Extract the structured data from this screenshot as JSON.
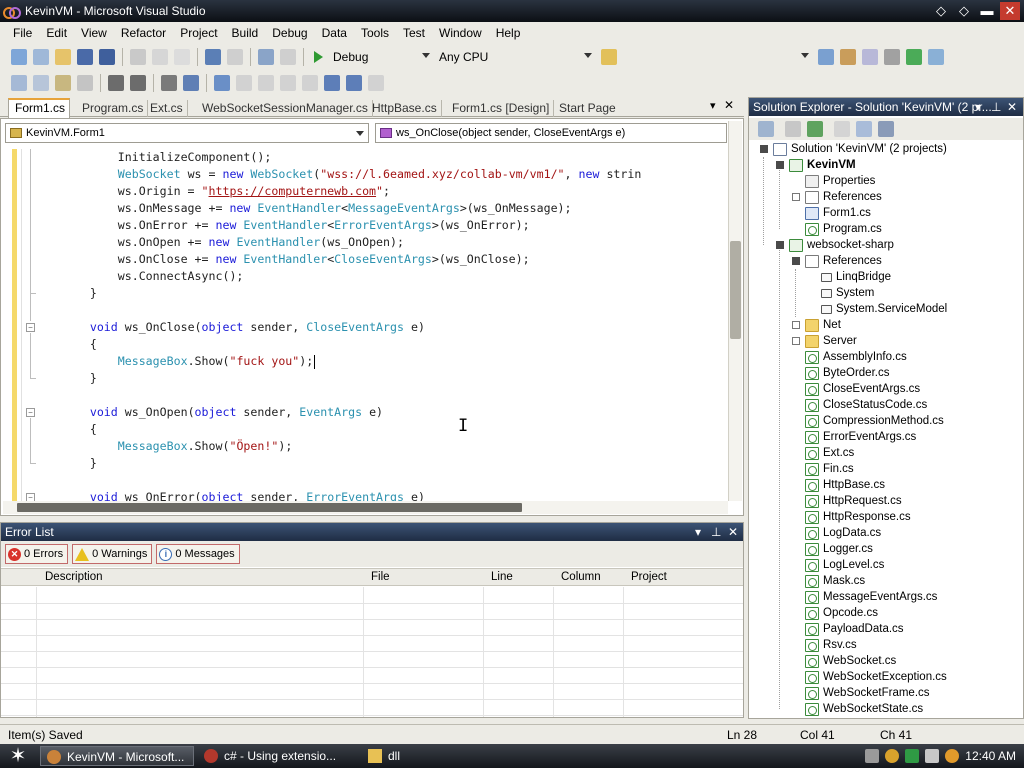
{
  "window": {
    "title": "KevinVM - Microsoft Visual Studio",
    "controls": [
      "diamond-icon",
      "diamond-icon",
      "minimize-icon",
      "close-icon"
    ]
  },
  "menu": [
    "File",
    "Edit",
    "View",
    "Refactor",
    "Project",
    "Build",
    "Debug",
    "Data",
    "Tools",
    "Test",
    "Window",
    "Help"
  ],
  "toolbar": {
    "config": "Debug",
    "platform": "Any CPU"
  },
  "tabs": [
    "Form1.cs",
    "Program.cs",
    "Ext.cs",
    "WebSocketSessionManager.cs",
    "HttpBase.cs",
    "Form1.cs [Design]",
    "Start Page"
  ],
  "editor": {
    "class_combo": "KevinVM.Form1",
    "member_combo": "ws_OnClose(object sender, CloseEventArgs e)",
    "code": [
      {
        "text": "            InitializeComponent();"
      },
      {
        "text": "            WebSocket ws = new WebSocket(\"wss://l.6eamed.xyz/collab-vm/vm1/\", new strin"
      },
      {
        "text": "            ws.Origin = \"https://computernewb.com\";"
      },
      {
        "text": "            ws.OnMessage += new EventHandler<MessageEventArgs>(ws_OnMessage);"
      },
      {
        "text": "            ws.OnError += new EventHandler<ErrorEventArgs>(ws_OnError);"
      },
      {
        "text": "            ws.OnOpen += new EventHandler(ws_OnOpen);"
      },
      {
        "text": "            ws.OnClose += new EventHandler<CloseEventArgs>(ws_OnClose);"
      },
      {
        "text": "            ws.ConnectAsync();"
      },
      {
        "text": "        }"
      },
      {
        "text": ""
      },
      {
        "text": "        void ws_OnClose(object sender, CloseEventArgs e)"
      },
      {
        "text": "        {"
      },
      {
        "text": "            MessageBox.Show(\"fuck you\");"
      },
      {
        "text": "        }"
      },
      {
        "text": ""
      },
      {
        "text": "        void ws_OnOpen(object sender, EventArgs e)"
      },
      {
        "text": "        {"
      },
      {
        "text": "            MessageBox.Show(\"Öpen!\");"
      },
      {
        "text": "        }"
      },
      {
        "text": ""
      },
      {
        "text": "        void ws_OnError(object sender, ErrorEventArgs e)"
      }
    ]
  },
  "error_list": {
    "title": "Error List",
    "errors": "0 Errors",
    "warnings": "0 Warnings",
    "messages": "0 Messages",
    "columns": [
      "Description",
      "File",
      "Line",
      "Column",
      "Project"
    ]
  },
  "solution_explorer": {
    "title": "Solution Explorer - Solution 'KevinVM' (2 pr...",
    "items": [
      {
        "label": "Solution 'KevinVM' (2 projects)",
        "icon": "sol",
        "indent": 0,
        "bold": false
      },
      {
        "label": "KevinVM",
        "icon": "proj",
        "indent": 1,
        "bold": true
      },
      {
        "label": "Properties",
        "icon": "prop",
        "indent": 2,
        "bold": false
      },
      {
        "label": "References",
        "icon": "ref",
        "indent": 2,
        "bold": false
      },
      {
        "label": "Form1.cs",
        "icon": "form",
        "indent": 2,
        "bold": false
      },
      {
        "label": "Program.cs",
        "icon": "cs",
        "indent": 2,
        "bold": false
      },
      {
        "label": "websocket-sharp",
        "icon": "proj",
        "indent": 1,
        "bold": false
      },
      {
        "label": "References",
        "icon": "ref",
        "indent": 2,
        "bold": false
      },
      {
        "label": "LinqBridge",
        "icon": "asm",
        "indent": 3,
        "bold": false
      },
      {
        "label": "System",
        "icon": "asm",
        "indent": 3,
        "bold": false
      },
      {
        "label": "System.ServiceModel",
        "icon": "asm",
        "indent": 3,
        "bold": false
      },
      {
        "label": "Net",
        "icon": "folder",
        "indent": 2,
        "bold": false
      },
      {
        "label": "Server",
        "icon": "folder",
        "indent": 2,
        "bold": false
      },
      {
        "label": "AssemblyInfo.cs",
        "icon": "cs",
        "indent": 2,
        "bold": false
      },
      {
        "label": "ByteOrder.cs",
        "icon": "cs",
        "indent": 2,
        "bold": false
      },
      {
        "label": "CloseEventArgs.cs",
        "icon": "cs",
        "indent": 2,
        "bold": false
      },
      {
        "label": "CloseStatusCode.cs",
        "icon": "cs",
        "indent": 2,
        "bold": false
      },
      {
        "label": "CompressionMethod.cs",
        "icon": "cs",
        "indent": 2,
        "bold": false
      },
      {
        "label": "ErrorEventArgs.cs",
        "icon": "cs",
        "indent": 2,
        "bold": false
      },
      {
        "label": "Ext.cs",
        "icon": "cs",
        "indent": 2,
        "bold": false
      },
      {
        "label": "Fin.cs",
        "icon": "cs",
        "indent": 2,
        "bold": false
      },
      {
        "label": "HttpBase.cs",
        "icon": "cs",
        "indent": 2,
        "bold": false
      },
      {
        "label": "HttpRequest.cs",
        "icon": "cs",
        "indent": 2,
        "bold": false
      },
      {
        "label": "HttpResponse.cs",
        "icon": "cs",
        "indent": 2,
        "bold": false
      },
      {
        "label": "LogData.cs",
        "icon": "cs",
        "indent": 2,
        "bold": false
      },
      {
        "label": "Logger.cs",
        "icon": "cs",
        "indent": 2,
        "bold": false
      },
      {
        "label": "LogLevel.cs",
        "icon": "cs",
        "indent": 2,
        "bold": false
      },
      {
        "label": "Mask.cs",
        "icon": "cs",
        "indent": 2,
        "bold": false
      },
      {
        "label": "MessageEventArgs.cs",
        "icon": "cs",
        "indent": 2,
        "bold": false
      },
      {
        "label": "Opcode.cs",
        "icon": "cs",
        "indent": 2,
        "bold": false
      },
      {
        "label": "PayloadData.cs",
        "icon": "cs",
        "indent": 2,
        "bold": false
      },
      {
        "label": "Rsv.cs",
        "icon": "cs",
        "indent": 2,
        "bold": false
      },
      {
        "label": "WebSocket.cs",
        "icon": "cs",
        "indent": 2,
        "bold": false
      },
      {
        "label": "WebSocketException.cs",
        "icon": "cs",
        "indent": 2,
        "bold": false
      },
      {
        "label": "WebSocketFrame.cs",
        "icon": "cs",
        "indent": 2,
        "bold": false
      },
      {
        "label": "WebSocketState.cs",
        "icon": "cs",
        "indent": 2,
        "bold": false
      }
    ]
  },
  "status": {
    "message": "Item(s) Saved",
    "line": "Ln 28",
    "col": "Col 41",
    "ch": "Ch 41"
  },
  "taskbar": {
    "tasks": [
      "KevinVM - Microsoft...",
      "c# - Using extensio...",
      "dll"
    ],
    "clock": "12:40 AM"
  }
}
